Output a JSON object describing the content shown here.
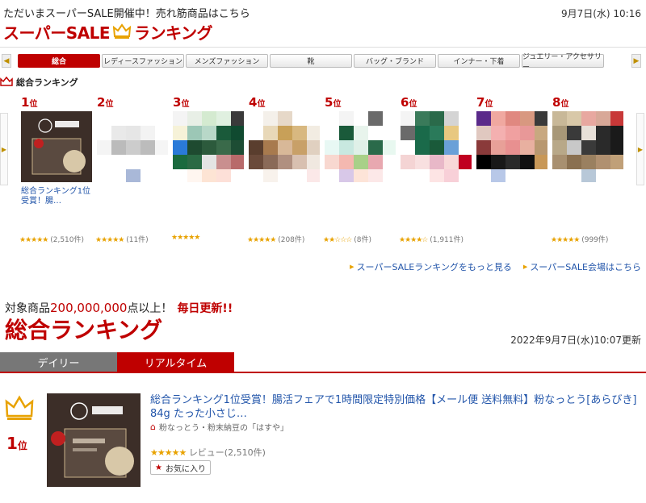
{
  "header": {
    "banner": "ただいまスーパーSALE開催中！売れ筋商品はこちら",
    "datetime": "9月7日(水) 10:16",
    "logo_left": "スーパーSALE",
    "logo_right": "ランキング"
  },
  "category_tabs": {
    "prev_icon": "◀",
    "next_icon": "▶",
    "items": [
      "総合",
      "レディースファッション",
      "メンズファッション",
      "靴",
      "バッグ・ブランド",
      "インナー・下着",
      "ジュエリー・アクセサリー"
    ]
  },
  "section_title": "総合ランキング",
  "rankings": [
    {
      "rank": "1",
      "suffix": "位",
      "title": "総合ランキング1位受賞！腸…",
      "stars": "★★★★★",
      "count": "(2,510件)"
    },
    {
      "rank": "2",
      "suffix": "位",
      "title": "",
      "stars": "★★★★★",
      "count": "(11件)"
    },
    {
      "rank": "3",
      "suffix": "位",
      "title": "",
      "stars": "★★★★★",
      "count": ""
    },
    {
      "rank": "4",
      "suffix": "位",
      "title": "",
      "stars": "★★★★★",
      "count": "(208件)"
    },
    {
      "rank": "5",
      "suffix": "位",
      "title": "",
      "stars": "★★☆☆☆",
      "count": "(8件)"
    },
    {
      "rank": "6",
      "suffix": "位",
      "title": "",
      "stars": "★★★★☆",
      "count": "(1,911件)"
    },
    {
      "rank": "7",
      "suffix": "位",
      "title": "",
      "stars": "",
      "count": ""
    },
    {
      "rank": "8",
      "suffix": "位",
      "title": "",
      "stars": "★★★★★",
      "count": "(999件)"
    }
  ],
  "links": {
    "more_ranking": "スーパーSALEランキングをもっと見る",
    "sale_venue": "スーパーSALE会場はこちら"
  },
  "summary": {
    "target_prefix": "対象商品",
    "target_number": "200,000,000",
    "target_suffix": "点以上！",
    "daily_update": "毎日更新!!",
    "big_title": "総合ランキング",
    "updated": "2022年9月7日(水)10:07更新"
  },
  "mode_tabs": {
    "daily": "デイリー",
    "realtime": "リアルタイム"
  },
  "first_item": {
    "rank": "1",
    "suffix": "位",
    "title": "総合ランキング1位受賞！腸活フェアで1時間限定特別価格【メール便 送料無料】粉なっとう[あらびき] 84g たった小さじ…",
    "shop": "粉なっとう・粉末納豆の「はすや」",
    "stars": "★★★★★",
    "review": "レビュー(2,510件)",
    "favorite": "お気に入り"
  },
  "colors": {
    "brand_red": "#bf0000",
    "gold": "#e8a200",
    "link_blue": "#2255aa"
  }
}
